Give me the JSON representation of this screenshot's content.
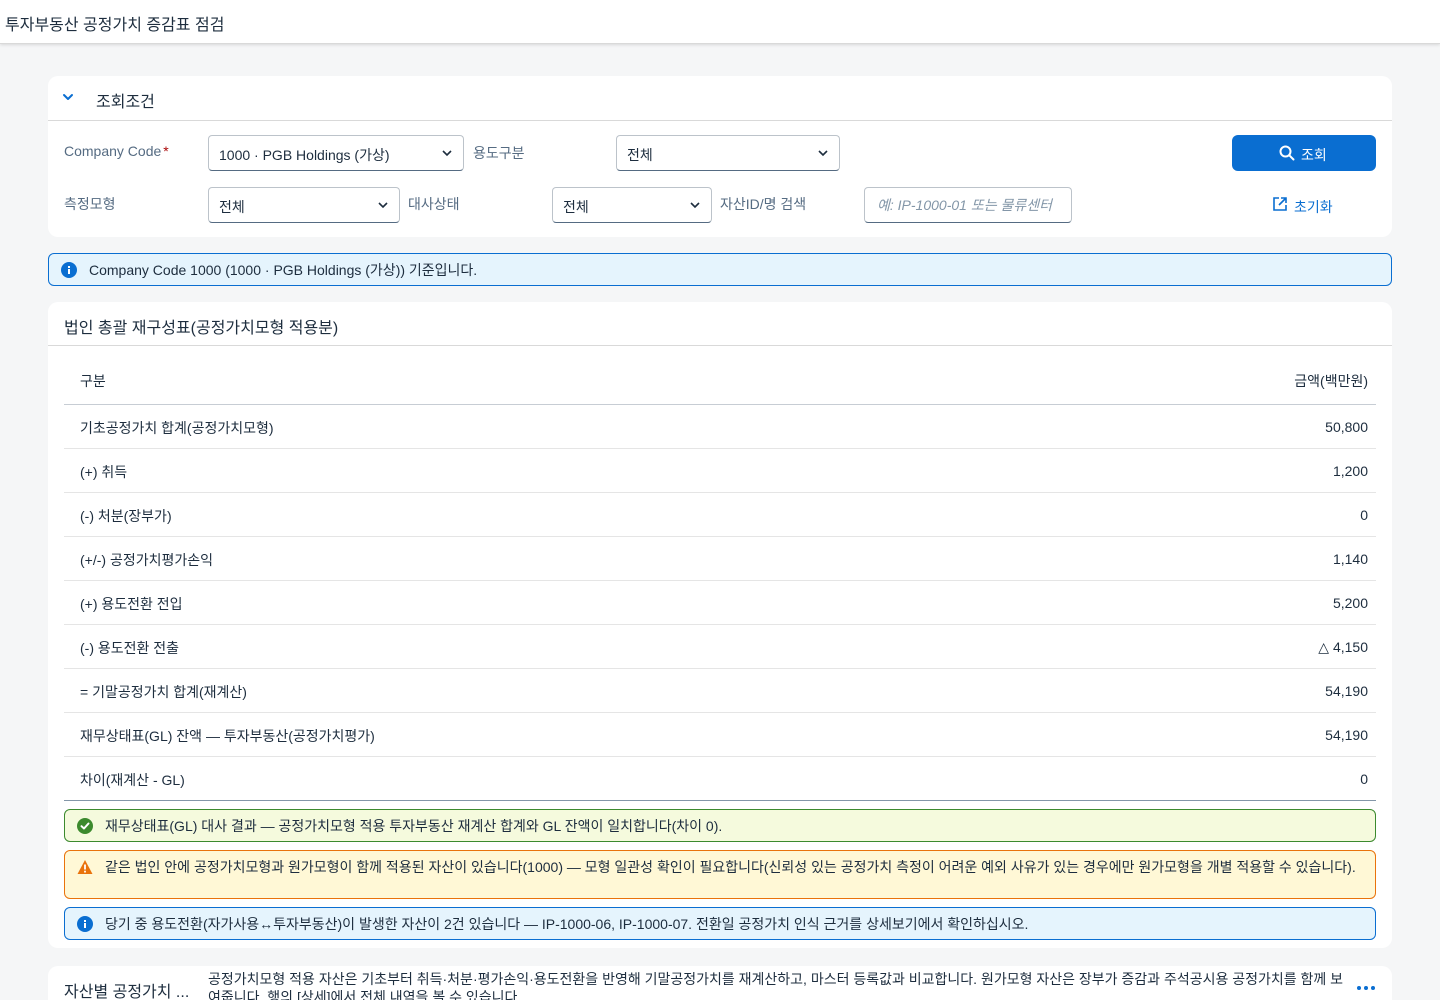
{
  "app": {
    "title": "투자부동산 공정가치 증감표 점검"
  },
  "filter": {
    "title": "조회조건",
    "company_code_label": "Company Code",
    "required_mark": "*",
    "company_code_value": "1000 · PGB Holdings (가상)",
    "usage_label": "용도구분",
    "usage_value": "전체",
    "model_label": "측정모형",
    "model_value": "전체",
    "recon_label": "대사상태",
    "recon_value": "전체",
    "asset_search_label": "자산ID/명 검색",
    "asset_search_placeholder": "예: IP-1000-01 또는 물류센터",
    "search_button": "조회",
    "reset_button": "초기화"
  },
  "info_banner": "Company Code 1000 (1000 · PGB Holdings (가상)) 기준입니다.",
  "statement": {
    "title": "법인 총괄 재구성표(공정가치모형 적용분)",
    "columns": [
      "구분",
      "금액(백만원)"
    ],
    "rows": [
      {
        "label": "기초공정가치 합계(공정가치모형)",
        "amount": "50,800"
      },
      {
        "label": "(+) 취득",
        "amount": "1,200"
      },
      {
        "label": "(-) 처분(장부가)",
        "amount": "0"
      },
      {
        "label": "(+/-) 공정가치평가손익",
        "amount": "1,140"
      },
      {
        "label": "(+) 용도전환 전입",
        "amount": "5,200"
      },
      {
        "label": "(-) 용도전환 전출",
        "amount": "△ 4,150"
      },
      {
        "label": "= 기말공정가치 합계(재계산)",
        "amount": "54,190"
      },
      {
        "label": "재무상태표(GL) 잔액 — 투자부동산(공정가치평가)",
        "amount": "54,190"
      },
      {
        "label": "차이(재계산 - GL)",
        "amount": "0"
      }
    ],
    "messages": {
      "success": "재무상태표(GL) 대사 결과 — 공정가치모형 적용 투자부동산 재계산 합계와 GL 잔액이 일치합니다(차이 0).",
      "warning": "같은 법인 안에 공정가치모형과 원가모형이 함께 적용된 자산이 있습니다(1000) — 모형 일관성 확인이 필요합니다(신뢰성 있는 공정가치 측정이 어려운 예외 사유가 있는 경우에만 원가모형을 개별 적용할 수 있습니다).",
      "info": "당기 중 용도전환(자가사용↔투자부동산)이 발생한 자산이 2건 있습니다 — IP-1000-06, IP-1000-07. 전환일 공정가치 인식 근거를 상세보기에서 확인하십시오."
    }
  },
  "asset_section": {
    "title": "자산별 공정가치 ...",
    "description": "공정가치모형 적용 자산은 기초부터 취득·처분·평가손익·용도전환을 반영해 기말공정가치를 재계산하고, 마스터 등록값과 비교합니다. 원가모형 자산은 장부가 증감과 주석공시용 공정가치를 함께 보여줍니다. 행의 [상세]에서 전체 내역을 볼 수 있습니다."
  },
  "colors": {
    "accent": "#0a6ed1",
    "success": "#3c8a2e",
    "warning": "#e9730c",
    "info": "#0a6ed1"
  }
}
